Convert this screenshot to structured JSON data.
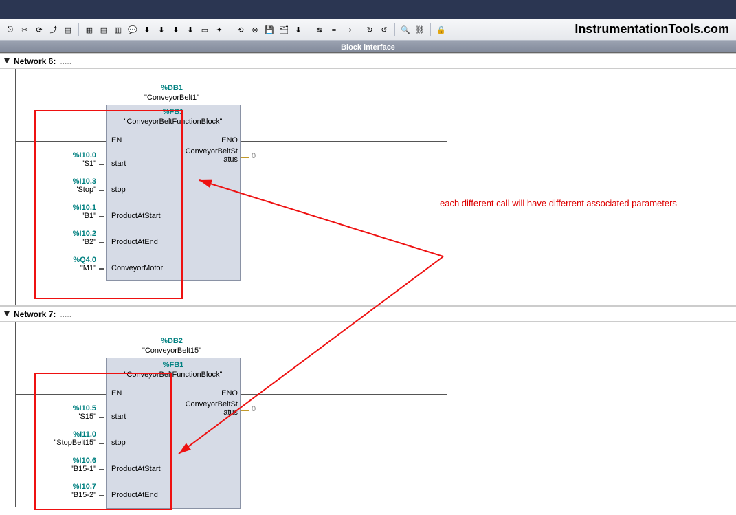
{
  "brand": "InstrumentationTools.com",
  "block_interface_label": "Block interface",
  "annot_text": "each different call will have differrent associated parameters",
  "net6": {
    "title": "Network 6:",
    "db_addr": "%DB1",
    "db_name": "\"ConveyorBelt1\"",
    "fb_addr": "%FB1",
    "fb_name": "\"ConveyorBeltFunctionBlock\"",
    "ports": {
      "en": "EN",
      "eno": "ENO",
      "status": "ConveyorBeltStatus",
      "out_val": "0"
    },
    "inputs": [
      {
        "addr": "%I10.0",
        "sym": "\"S1\"",
        "port": "start"
      },
      {
        "addr": "%I10.3",
        "sym": "\"Stop\"",
        "port": "stop"
      },
      {
        "addr": "%I10.1",
        "sym": "\"B1\"",
        "port": "ProductAtStart"
      },
      {
        "addr": "%I10.2",
        "sym": "\"B2\"",
        "port": "ProductAtEnd"
      },
      {
        "addr": "%Q4.0",
        "sym": "\"M1\"",
        "port": "ConveyorMotor"
      }
    ]
  },
  "net7": {
    "title": "Network 7:",
    "db_addr": "%DB2",
    "db_name": "\"ConveyorBelt15\"",
    "fb_addr": "%FB1",
    "fb_name": "\"ConveyorBeltFunctionBlock\"",
    "ports": {
      "en": "EN",
      "eno": "ENO",
      "status": "ConveyorBeltStatus",
      "out_val": "0"
    },
    "inputs": [
      {
        "addr": "%I10.5",
        "sym": "\"S15\"",
        "port": "start"
      },
      {
        "addr": "%I11.0",
        "sym": "\"StopBelt15\"",
        "port": "stop"
      },
      {
        "addr": "%I10.6",
        "sym": "\"B15-1\"",
        "port": "ProductAtStart"
      },
      {
        "addr": "%I10.7",
        "sym": "\"B15-2\"",
        "port": "ProductAtEnd"
      }
    ]
  }
}
